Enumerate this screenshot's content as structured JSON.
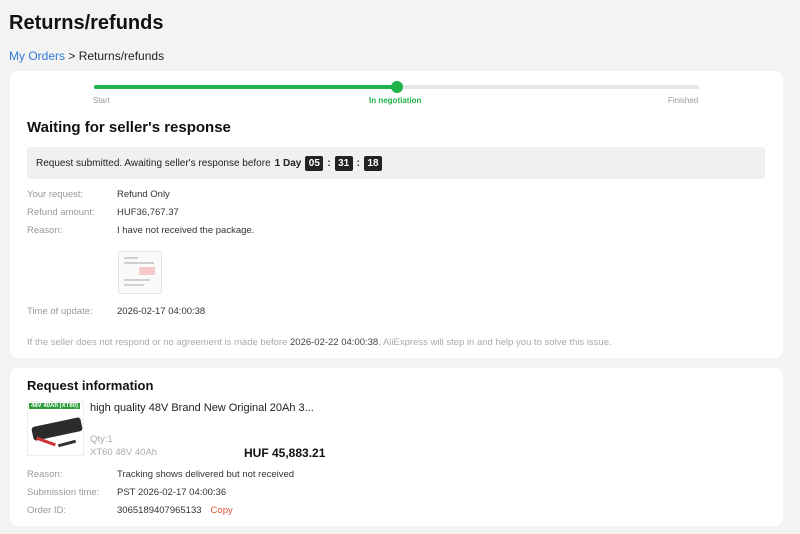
{
  "page": {
    "title": "Returns/refunds"
  },
  "breadcrumb": {
    "link": "My Orders",
    "separator": " > ",
    "current": "Returns/refunds"
  },
  "progress": {
    "fraction": 0.5,
    "steps": [
      "Start",
      "In negotiation",
      "Finished"
    ],
    "active_step": 1,
    "accent_color": "#1fb34a"
  },
  "status": {
    "heading": "Waiting for seller's response",
    "notice_text": "Request submitted. Awaiting seller's response before",
    "days": "1 Day",
    "hours": "05",
    "minutes": "31",
    "seconds": "18",
    "colon": ":"
  },
  "request": {
    "your_request_label": "Your request:",
    "your_request_value": "Refund Only",
    "amount_label": "Refund amount:",
    "amount_value": "HUF36,767.37",
    "reason_label": "Reason:",
    "reason_value": "I have not received the package.",
    "update_label": "Time of update:",
    "update_value": "2026-02-17 04:00:38"
  },
  "footnote": {
    "before": "If the seller does not respond or no agreement is made before ",
    "date": "2026-02-22 04:00:38",
    "after": ", AliExpress will step in and help you to solve this issue."
  },
  "request_info": {
    "heading": "Request information",
    "product_badge": "48V 40Ah (XT60)",
    "product_title": "high quality 48V Brand New Original 20Ah 3...",
    "qty": "Qty:1",
    "variant": "XT60 48V 40Ah",
    "price": "HUF 45,883.21",
    "reason_label": "Reason:",
    "reason_value": "Tracking shows delivered but not received",
    "submission_label": "Submission time:",
    "submission_value": "PST 2026-02-17 04:00:36",
    "order_label": "Order ID:",
    "order_value": "3065189407965133",
    "copy_label": "Copy",
    "copy_color": "#e0523a"
  }
}
